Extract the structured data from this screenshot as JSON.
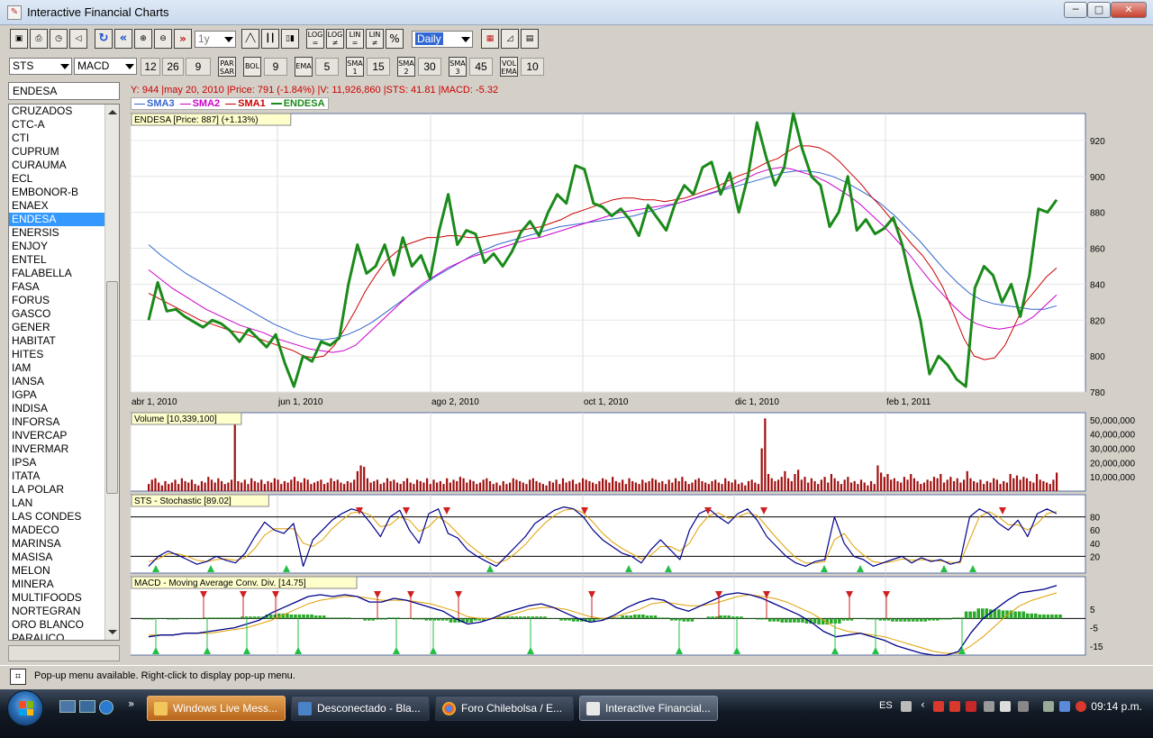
{
  "window": {
    "title": "Interactive Financial Charts",
    "buttons": {
      "minimize": "─",
      "maximize": "□",
      "close": "✕"
    }
  },
  "toolbar1": {
    "period": "1y",
    "interval": "Daily",
    "scale_buttons": [
      "LOG =",
      "LOG ≠",
      "LIN =",
      "LIN ≠",
      "%"
    ]
  },
  "toolbar2": {
    "symbol_combo": "STS",
    "indicator_combo": "MACD",
    "macd_params": [
      "12",
      "26",
      "9"
    ],
    "par_sar_label": "PAR SAR",
    "bol_label": "BOL",
    "bol_value": "9",
    "ema_label": "EMA",
    "ema_value": "5",
    "sma1_label": "SMA 1",
    "sma1_value": "15",
    "sma2_label": "SMA 2",
    "sma2_value": "30",
    "sma3_label": "SMA 3",
    "sma3_value": "45",
    "volema_label": "VOL EMA",
    "volema_value": "10"
  },
  "sidebar": {
    "symbol_field": "ENDESA",
    "selected": "ENDESA",
    "items": [
      "CRUZADOS",
      "CTC-A",
      "CTI",
      "CUPRUM",
      "CURAUMA",
      "ECL",
      "EMBONOR-B",
      "ENAEX",
      "ENDESA",
      "ENERSIS",
      "ENJOY",
      "ENTEL",
      "FALABELLA",
      "FASA",
      "FORUS",
      "GASCO",
      "GENER",
      "HABITAT",
      "HITES",
      "IAM",
      "IANSA",
      "IGPA",
      "INDISA",
      "INFORSA",
      "INVERCAP",
      "INVERMAR",
      "IPSA",
      "ITATA",
      "LA POLAR",
      "LAN",
      "LAS CONDES",
      "MADECO",
      "MARINSA",
      "MASISA",
      "MELON",
      "MINERA",
      "MULTIFOODS",
      "NORTEGRAN",
      "ORO BLANCO",
      "PARAUCO"
    ]
  },
  "info_line": "Y: 944 |may 20, 2010 |Price: 791 (-1.84%) |V: 11,926,860 |STS: 41.81 |MACD: -5.32",
  "legend": [
    {
      "name": "SMA3",
      "color": "#3366cc"
    },
    {
      "name": "SMA2",
      "color": "#cc00cc"
    },
    {
      "name": "SMA1",
      "color": "#cc0000"
    },
    {
      "name": "ENDESA",
      "color": "#1a8a1a"
    }
  ],
  "chart_data": [
    {
      "type": "line",
      "title": "ENDESA [Price: 887] (+1.13%)",
      "x_ticks": [
        "abr 1, 2010",
        "jun 1, 2010",
        "ago 2, 2010",
        "oct 1, 2010",
        "dic 1, 2010",
        "feb 1, 2011"
      ],
      "y_ticks": [
        "780",
        "800",
        "820",
        "840",
        "860",
        "880",
        "900",
        "920"
      ],
      "ylim": [
        780,
        935
      ],
      "series": [
        {
          "name": "ENDESA",
          "color": "#1a8a1a",
          "values": [
            820,
            841,
            825,
            826,
            822,
            819,
            816,
            820,
            818,
            814,
            808,
            815,
            810,
            805,
            812,
            796,
            783,
            800,
            797,
            808,
            806,
            810,
            840,
            862,
            846,
            850,
            862,
            845,
            866,
            850,
            856,
            843,
            870,
            890,
            862,
            870,
            868,
            852,
            857,
            850,
            858,
            869,
            875,
            867,
            880,
            890,
            885,
            906,
            904,
            885,
            883,
            878,
            882,
            876,
            867,
            884,
            877,
            870,
            885,
            895,
            890,
            905,
            908,
            890,
            902,
            880,
            900,
            930,
            911,
            895,
            905,
            935,
            915,
            900,
            895,
            872,
            880,
            900,
            870,
            876,
            868,
            871,
            877,
            862,
            840,
            820,
            790,
            800,
            795,
            787,
            783,
            838,
            850,
            845,
            830,
            840,
            822,
            845,
            882,
            880,
            887
          ]
        },
        {
          "name": "SMA1",
          "color": "#cc0000",
          "values": [
            835,
            832,
            829,
            826,
            823,
            820,
            818,
            816,
            814,
            813,
            811,
            809,
            807,
            805,
            803,
            800,
            799,
            800,
            806,
            815,
            825,
            836,
            845,
            853,
            858,
            862,
            864,
            866,
            866,
            867,
            867,
            866,
            866,
            867,
            868,
            869,
            870,
            871,
            872,
            874,
            876,
            879,
            881,
            883,
            885,
            887,
            888,
            888,
            887,
            887,
            886,
            887,
            888,
            890,
            892,
            894,
            897,
            900,
            902,
            905,
            908,
            910,
            914,
            917,
            917,
            916,
            913,
            908,
            902,
            896,
            889,
            883,
            876,
            869,
            862,
            856,
            848,
            838,
            824,
            810,
            800,
            798,
            799,
            806,
            818,
            830,
            837,
            844,
            849
          ]
        },
        {
          "name": "SMA2",
          "color": "#cc00cc",
          "values": [
            848,
            843,
            838,
            834,
            830,
            826,
            823,
            820,
            817,
            815,
            813,
            810,
            808,
            806,
            804,
            803,
            802,
            803,
            806,
            812,
            818,
            824,
            830,
            836,
            841,
            845,
            849,
            852,
            855,
            857,
            859,
            861,
            863,
            865,
            866,
            868,
            870,
            872,
            874,
            876,
            878,
            880,
            881,
            882,
            883,
            884,
            885,
            887,
            889,
            891,
            893,
            896,
            899,
            902,
            904,
            905,
            904,
            902,
            900,
            897,
            893,
            889,
            884,
            878,
            872,
            865,
            858,
            850,
            842,
            835,
            828,
            822,
            818,
            816,
            815,
            816,
            818,
            822,
            828,
            834
          ]
        },
        {
          "name": "SMA3",
          "color": "#3366cc",
          "values": [
            862,
            856,
            851,
            846,
            842,
            838,
            834,
            830,
            826,
            822,
            818,
            815,
            812,
            810,
            809,
            810,
            812,
            815,
            819,
            824,
            829,
            834,
            839,
            844,
            848,
            852,
            856,
            859,
            862,
            864,
            866,
            868,
            870,
            872,
            873,
            874,
            875,
            876,
            877,
            878,
            880,
            882,
            884,
            886,
            888,
            890,
            892,
            894,
            896,
            898,
            900,
            902,
            903,
            903,
            902,
            900,
            897,
            893,
            889,
            884,
            878,
            871,
            864,
            856,
            848,
            841,
            835,
            831,
            829,
            828,
            827,
            826,
            826,
            828
          ]
        }
      ]
    },
    {
      "type": "bar",
      "title": "Volume [10,339,100]",
      "y_ticks": [
        "10,000,000",
        "20,000,000",
        "30,000,000",
        "40,000,000",
        "50,000,000"
      ],
      "ylim": [
        0,
        55000000
      ],
      "values": [
        5,
        8,
        9,
        6,
        4,
        7,
        5,
        6,
        8,
        5,
        9,
        7,
        6,
        8,
        5,
        4,
        7,
        6,
        10,
        8,
        6,
        9,
        7,
        5,
        6,
        8,
        49,
        7,
        6,
        8,
        5,
        9,
        7,
        6,
        8,
        5,
        7,
        6,
        9,
        8,
        5,
        7,
        6,
        8,
        10,
        7,
        6,
        9,
        8,
        5,
        6,
        7,
        8,
        5,
        6,
        9,
        7,
        8,
        6,
        5,
        7,
        6,
        8,
        14,
        18,
        17,
        9,
        6,
        7,
        8,
        5,
        6,
        9,
        7,
        8,
        6,
        5,
        7,
        9,
        6,
        5,
        8,
        7,
        6,
        9,
        5,
        8,
        6,
        7,
        5,
        9,
        6,
        8,
        7,
        10,
        9,
        6,
        8,
        7,
        5,
        6,
        8,
        9,
        7,
        5,
        6,
        4,
        7,
        5,
        6,
        9,
        8,
        7,
        6,
        5,
        8,
        9,
        7,
        6,
        5,
        4,
        7,
        6,
        8,
        5,
        9,
        6,
        7,
        8,
        5,
        6,
        9,
        8,
        7,
        6,
        5,
        7,
        9,
        8,
        6,
        10,
        7,
        6,
        8,
        5,
        9,
        7,
        6,
        5,
        8,
        6,
        7,
        9,
        8,
        6,
        7,
        5,
        8,
        6,
        9,
        7,
        10,
        7,
        5,
        6,
        8,
        9,
        7,
        6,
        5,
        7,
        8,
        6,
        5,
        9,
        7,
        6,
        8,
        5,
        6,
        4,
        7,
        8,
        6,
        5,
        30,
        51,
        12,
        9,
        7,
        8,
        10,
        14,
        9,
        7,
        12,
        15,
        8,
        10,
        6,
        9,
        7,
        5,
        8,
        10,
        6,
        12,
        9,
        7,
        5,
        8,
        10,
        6,
        7,
        5,
        8,
        6,
        4,
        7,
        5,
        18,
        13,
        10,
        12,
        8,
        9,
        7,
        6,
        10,
        8,
        12,
        9,
        7,
        5,
        6,
        8,
        7,
        10,
        9,
        12,
        6,
        8,
        10,
        7,
        9,
        6,
        8,
        14,
        9,
        7,
        6,
        8,
        5,
        7,
        6,
        9,
        8,
        5,
        7,
        6,
        12,
        9,
        11,
        8,
        10,
        9,
        7,
        6,
        12,
        8,
        7,
        6,
        5,
        8,
        13
      ]
    },
    {
      "type": "line",
      "title": "STS - Stochastic [89.02]",
      "y_ticks": [
        "20",
        "40",
        "60",
        "80"
      ],
      "ylim": [
        0,
        100
      ],
      "series": [
        {
          "name": "%K",
          "color": "#00008b",
          "values": [
            5,
            20,
            28,
            22,
            15,
            8,
            12,
            20,
            14,
            10,
            25,
            50,
            72,
            60,
            55,
            70,
            5,
            45,
            60,
            75,
            85,
            92,
            88,
            70,
            50,
            80,
            90,
            60,
            40,
            85,
            92,
            55,
            48,
            30,
            20,
            12,
            5,
            20,
            35,
            50,
            70,
            80,
            90,
            95,
            92,
            80,
            60,
            45,
            35,
            25,
            20,
            10,
            30,
            45,
            30,
            15,
            60,
            85,
            92,
            80,
            70,
            85,
            92,
            75,
            50,
            35,
            20,
            10,
            5,
            12,
            15,
            80,
            40,
            20,
            15,
            5,
            10,
            15,
            20,
            10,
            18,
            12,
            15,
            8,
            12,
            80,
            92,
            85,
            70,
            60,
            75,
            50,
            85,
            92,
            85
          ]
        },
        {
          "name": "%D",
          "color": "#e0a000",
          "values": [
            12,
            16,
            24,
            24,
            20,
            14,
            12,
            15,
            16,
            14,
            18,
            32,
            52,
            62,
            62,
            62,
            40,
            35,
            45,
            62,
            75,
            86,
            88,
            82,
            65,
            68,
            80,
            75,
            58,
            65,
            80,
            70,
            55,
            40,
            28,
            18,
            10,
            14,
            25,
            38,
            55,
            70,
            82,
            90,
            92,
            86,
            72,
            55,
            42,
            32,
            24,
            16,
            22,
            35,
            35,
            28,
            40,
            65,
            82,
            86,
            78,
            80,
            86,
            82,
            65,
            48,
            32,
            18,
            10,
            10,
            12,
            45,
            55,
            35,
            22,
            12,
            10,
            12,
            16,
            14,
            15,
            14,
            13,
            11,
            10,
            45,
            80,
            88,
            80,
            68,
            68,
            60,
            70,
            85,
            88
          ]
        }
      ]
    },
    {
      "type": "line",
      "title": "MACD - Moving Average Conv. Div. [14.75]",
      "y_ticks": [
        "5",
        "-5",
        "-15"
      ],
      "ylim": [
        -20,
        20
      ],
      "series": [
        {
          "name": "MACD",
          "color": "#00008b",
          "values": [
            -10,
            -9,
            -9,
            -8,
            -8,
            -7,
            -6,
            -5,
            -3,
            -1,
            3,
            6,
            9,
            12,
            13,
            12,
            13,
            12,
            9,
            9,
            11,
            10,
            8,
            6,
            4,
            0,
            -3,
            -2,
            0,
            3,
            5,
            7,
            8,
            6,
            3,
            0,
            -2,
            -1,
            2,
            6,
            9,
            11,
            10,
            6,
            4,
            7,
            10,
            13,
            14,
            13,
            11,
            8,
            5,
            2,
            -2,
            -7,
            -10,
            -9,
            -8,
            -10,
            -12,
            -15,
            -17,
            -19,
            -20,
            -20,
            -18,
            -8,
            0,
            5,
            10,
            14,
            15,
            16,
            18
          ]
        },
        {
          "name": "Signal",
          "color": "#e0a000",
          "values": [
            -9,
            -9,
            -9,
            -8,
            -8,
            -8,
            -7,
            -6,
            -5,
            -3,
            -1,
            2,
            5,
            8,
            10,
            11,
            12,
            12,
            11,
            10,
            10,
            10,
            9,
            8,
            6,
            4,
            1,
            0,
            0,
            1,
            3,
            5,
            6,
            6,
            5,
            3,
            1,
            0,
            1,
            3,
            5,
            8,
            9,
            8,
            7,
            7,
            8,
            10,
            12,
            13,
            12,
            11,
            9,
            6,
            3,
            -1,
            -5,
            -7,
            -8,
            -9,
            -10,
            -12,
            -14,
            -16,
            -18,
            -19,
            -19,
            -15,
            -10,
            -4,
            2,
            7,
            10,
            12,
            14
          ]
        }
      ],
      "histogram": [
        -1,
        0,
        -1,
        0,
        0,
        1,
        1,
        1,
        2,
        2,
        4,
        5,
        4,
        4,
        3,
        1,
        1,
        0,
        -2,
        -1,
        1,
        0,
        -1,
        -2,
        -2,
        -4,
        -4,
        -2,
        0,
        2,
        2,
        2,
        2,
        0,
        -2,
        -3,
        -3,
        -1,
        1,
        3,
        4,
        3,
        1,
        -2,
        -3,
        0,
        2,
        3,
        2,
        0,
        -1,
        -3,
        -4,
        -4,
        -5,
        -6,
        -5,
        -2,
        0,
        -1,
        -2,
        -3,
        -3,
        -3,
        -2,
        -1,
        1,
        7,
        10,
        9,
        8,
        7,
        5,
        4,
        4
      ]
    }
  ],
  "statusbar": {
    "text": "Pop-up menu available. Right-click to display pop-up menu."
  },
  "taskbar": {
    "tasks": [
      "Windows Live Mess...",
      "Desconectado - Bla...",
      "Foro Chilebolsa / E...",
      "Interactive Financial..."
    ],
    "language": "ES",
    "clock": "09:14 p.m."
  }
}
